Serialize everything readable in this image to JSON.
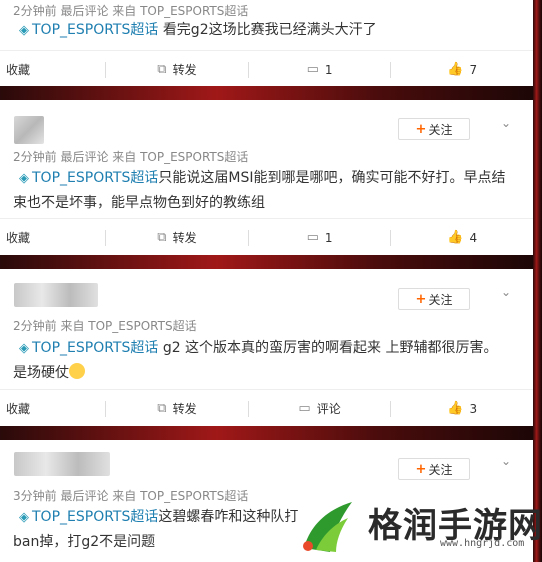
{
  "comments": [
    {
      "meta": "2分钟前 最后评论 来自 TOP_ESPORTS超话",
      "topic": "TOP_ESPORTS超话",
      "text_line1": "看完g2这场比赛我已经满头大汗了",
      "text_line2": "",
      "actions": {
        "collect": "收藏",
        "repost": "转发",
        "comment": "1",
        "like": "7"
      }
    },
    {
      "meta": "2分钟前 最后评论 来自 TOP_ESPORTS超话",
      "follow": "关注",
      "topic": "TOP_ESPORTS超话",
      "text_line1": "只能说这届MSI能到哪是哪吧，确实可能不好打。早点结",
      "text_line2": "束也不是坏事，能早点物色到好的教练组",
      "actions": {
        "collect": "收藏",
        "repost": "转发",
        "comment": "1",
        "like": "4"
      }
    },
    {
      "meta": "2分钟前 来自 TOP_ESPORTS超话",
      "follow": "关注",
      "topic": "TOP_ESPORTS超话",
      "text_line1": "g2 这个版本真的蛮厉害的啊看起来 上野辅都很厉害。",
      "text_line2": "是场硬仗",
      "actions": {
        "collect": "收藏",
        "repost": "转发",
        "comment": "评论",
        "like": "3"
      }
    },
    {
      "meta": "3分钟前 最后评论 来自 TOP_ESPORTS超话",
      "follow": "关注",
      "topic": "TOP_ESPORTS超话",
      "text_line1": "这碧螺春咋和这种队打",
      "text_line2": "ban掉，打g2不是问题"
    }
  ],
  "watermark": {
    "name": "格润手游网",
    "url": "www.hngrjd.com"
  }
}
